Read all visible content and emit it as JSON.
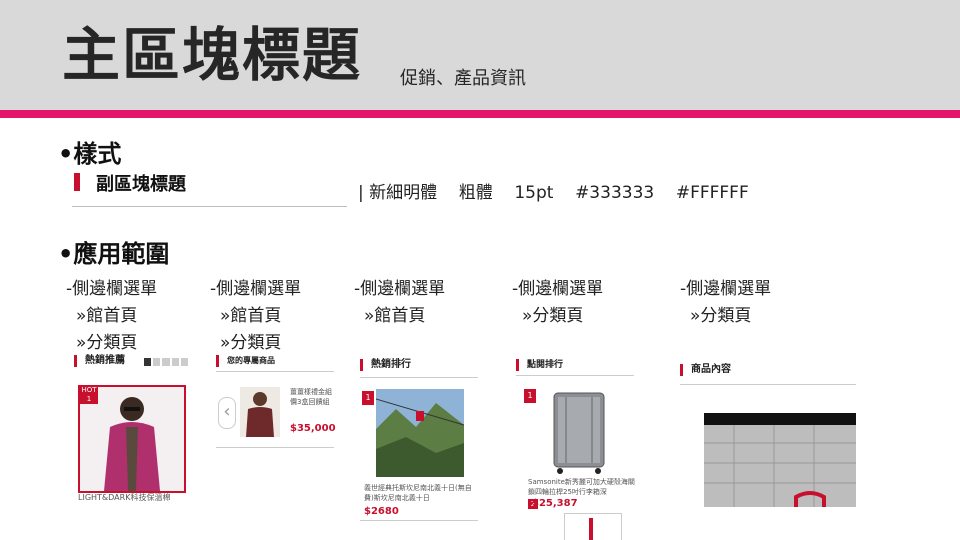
{
  "header": {
    "title": "主區塊標題",
    "subtitle": "促銷、產品資訊"
  },
  "style_section": {
    "heading": "•樣式",
    "sample_label": "副區塊標題",
    "spec": "| 新細明體    粗體    15pt    #333333    #FFFFFF"
  },
  "usage_section": {
    "heading": "•應用範圍",
    "columns": [
      {
        "line1": "-側邊欄選單",
        "line2": "»館首頁",
        "line3": "»分類頁"
      },
      {
        "line1": "-側邊欄選單",
        "line2": "»館首頁",
        "line3": "»分類頁"
      },
      {
        "line1": "-側邊欄選單",
        "line2": "»館首頁",
        "line3": ""
      },
      {
        "line1": "-側邊欄選單",
        "line2": "»分類頁",
        "line3": ""
      },
      {
        "line1": "-側邊欄選單",
        "line2": "»分類頁",
        "line3": ""
      }
    ]
  },
  "thumbs": {
    "t1": {
      "title": "熱銷推薦",
      "badge": "HOT 1",
      "caption": "LIGHT&DARK科技保溫棉"
    },
    "t2": {
      "title": "您的專屬商品",
      "desc": "薑薑樣禮金組 價3盒回饋組",
      "price": "$35,000"
    },
    "t3": {
      "title": "熱銷排行",
      "badge": "1",
      "desc": "義世經典托斯坎尼南北義十日(無自費)斯坎尼南北義十日",
      "price": "$2680"
    },
    "t4": {
      "title": "點閱排行",
      "badge1": "1",
      "desc": "Samsonite新秀麗可加大硬殼海關鎖四輪拉桿25吋行李箱深",
      "badge2": "2",
      "price": "$25,387"
    },
    "t5": {
      "title": "商品內容"
    }
  },
  "colors": {
    "accent": "#e3146b",
    "red": "#c8102e",
    "header_bg": "#d9d9d9"
  }
}
